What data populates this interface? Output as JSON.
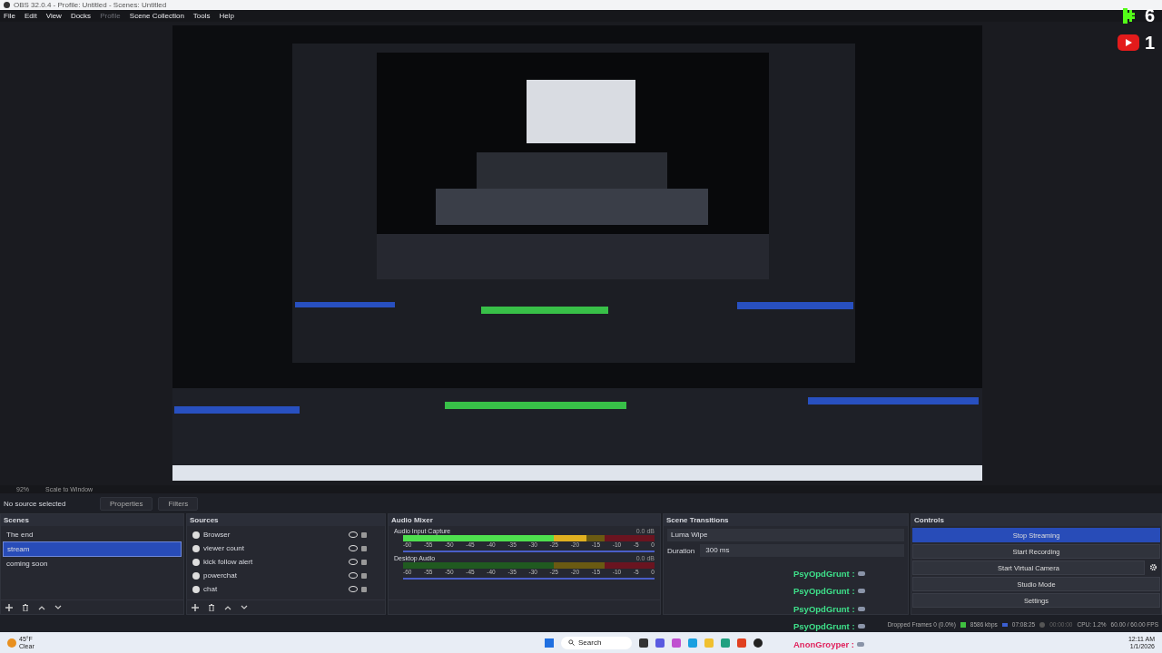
{
  "window": {
    "title": "OBS 32.0.4 - Profile: Untitled - Scenes: Untitled"
  },
  "menu": [
    {
      "label": "File",
      "disabled": false
    },
    {
      "label": "Edit",
      "disabled": false
    },
    {
      "label": "View",
      "disabled": false
    },
    {
      "label": "Docks",
      "disabled": false
    },
    {
      "label": "Profile",
      "disabled": true
    },
    {
      "label": "Scene Collection",
      "disabled": false
    },
    {
      "label": "Tools",
      "disabled": false
    },
    {
      "label": "Help",
      "disabled": false
    }
  ],
  "scale_bar": {
    "zoom": "92%",
    "mode": "Scale to Window"
  },
  "source_toolbar": {
    "status": "No source selected",
    "buttons": [
      "Properties",
      "Filters"
    ]
  },
  "scenes": {
    "title": "Scenes",
    "items": [
      {
        "label": "The end",
        "selected": false
      },
      {
        "label": "stream",
        "selected": true
      },
      {
        "label": "coming soon",
        "selected": false
      }
    ]
  },
  "sources": {
    "title": "Sources",
    "items": [
      {
        "label": "Browser",
        "visible": true
      },
      {
        "label": "viewer count",
        "visible": true
      },
      {
        "label": "kick follow alert",
        "visible": true
      },
      {
        "label": "powerchat",
        "visible": true
      },
      {
        "label": "chat",
        "visible": true
      }
    ]
  },
  "audio_mixer": {
    "title": "Audio Mixer",
    "tracks": [
      {
        "name": "Audio Input Capture",
        "reading": "0.0 dB",
        "level": 0.73,
        "volume": {
          "level": 1
        },
        "ticks": [
          "-60",
          "-55",
          "-50",
          "-45",
          "-40",
          "-35",
          "-30",
          "-25",
          "-20",
          "-15",
          "-10",
          "-5",
          "0"
        ]
      },
      {
        "name": "Desktop Audio",
        "reading": "0.0 dB",
        "volume": {
          "level": 1
        },
        "ticks": [
          "-60",
          "-55",
          "-50",
          "-45",
          "-40",
          "-35",
          "-30",
          "-25",
          "-20",
          "-15",
          "-10",
          "-5",
          "0"
        ]
      }
    ]
  },
  "scene_transitions": {
    "title": "Scene Transitions",
    "transition": "Luma Wipe",
    "duration_label": "Duration",
    "duration": "300 ms"
  },
  "controls": {
    "title": "Controls",
    "buttons": [
      {
        "label": "Stop Streaming",
        "active": true,
        "kind": "plain"
      },
      {
        "label": "Start Recording",
        "active": false,
        "kind": "plain"
      },
      {
        "label": "Start Virtual Camera",
        "active": false,
        "kind": "gear"
      },
      {
        "label": "Studio Mode",
        "active": false,
        "kind": "plain"
      },
      {
        "label": "Settings",
        "active": false,
        "kind": "plain"
      }
    ]
  },
  "status_bar": {
    "dropped": "Dropped Frames 0 (0.0%)",
    "bitrate": "8586 kbps",
    "stream_time": "07:08:25",
    "record_time": "00:00:00",
    "cpu": "CPU: 1.2%",
    "fps": "60.00 / 60.00 FPS"
  },
  "taskbar": {
    "temperature": "45°F",
    "weather": "Clear",
    "search": "Search",
    "time": "12:11 AM",
    "date": "1/1/2026"
  },
  "overlay": {
    "counters": [
      {
        "kind": "kick",
        "count": "6"
      },
      {
        "kind": "youtube",
        "count": "1"
      }
    ],
    "chat": [
      {
        "user": "PsyOpdGrunt :",
        "color": "#3ee08a"
      },
      {
        "user": "PsyOpdGrunt :",
        "color": "#3ee08a"
      },
      {
        "user": "PsyOpdGrunt :",
        "color": "#3ee08a"
      },
      {
        "user": "PsyOpdGrunt :",
        "color": "#3ee08a"
      },
      {
        "user": "AnonGroyper :",
        "color": "#e0245e"
      }
    ]
  }
}
